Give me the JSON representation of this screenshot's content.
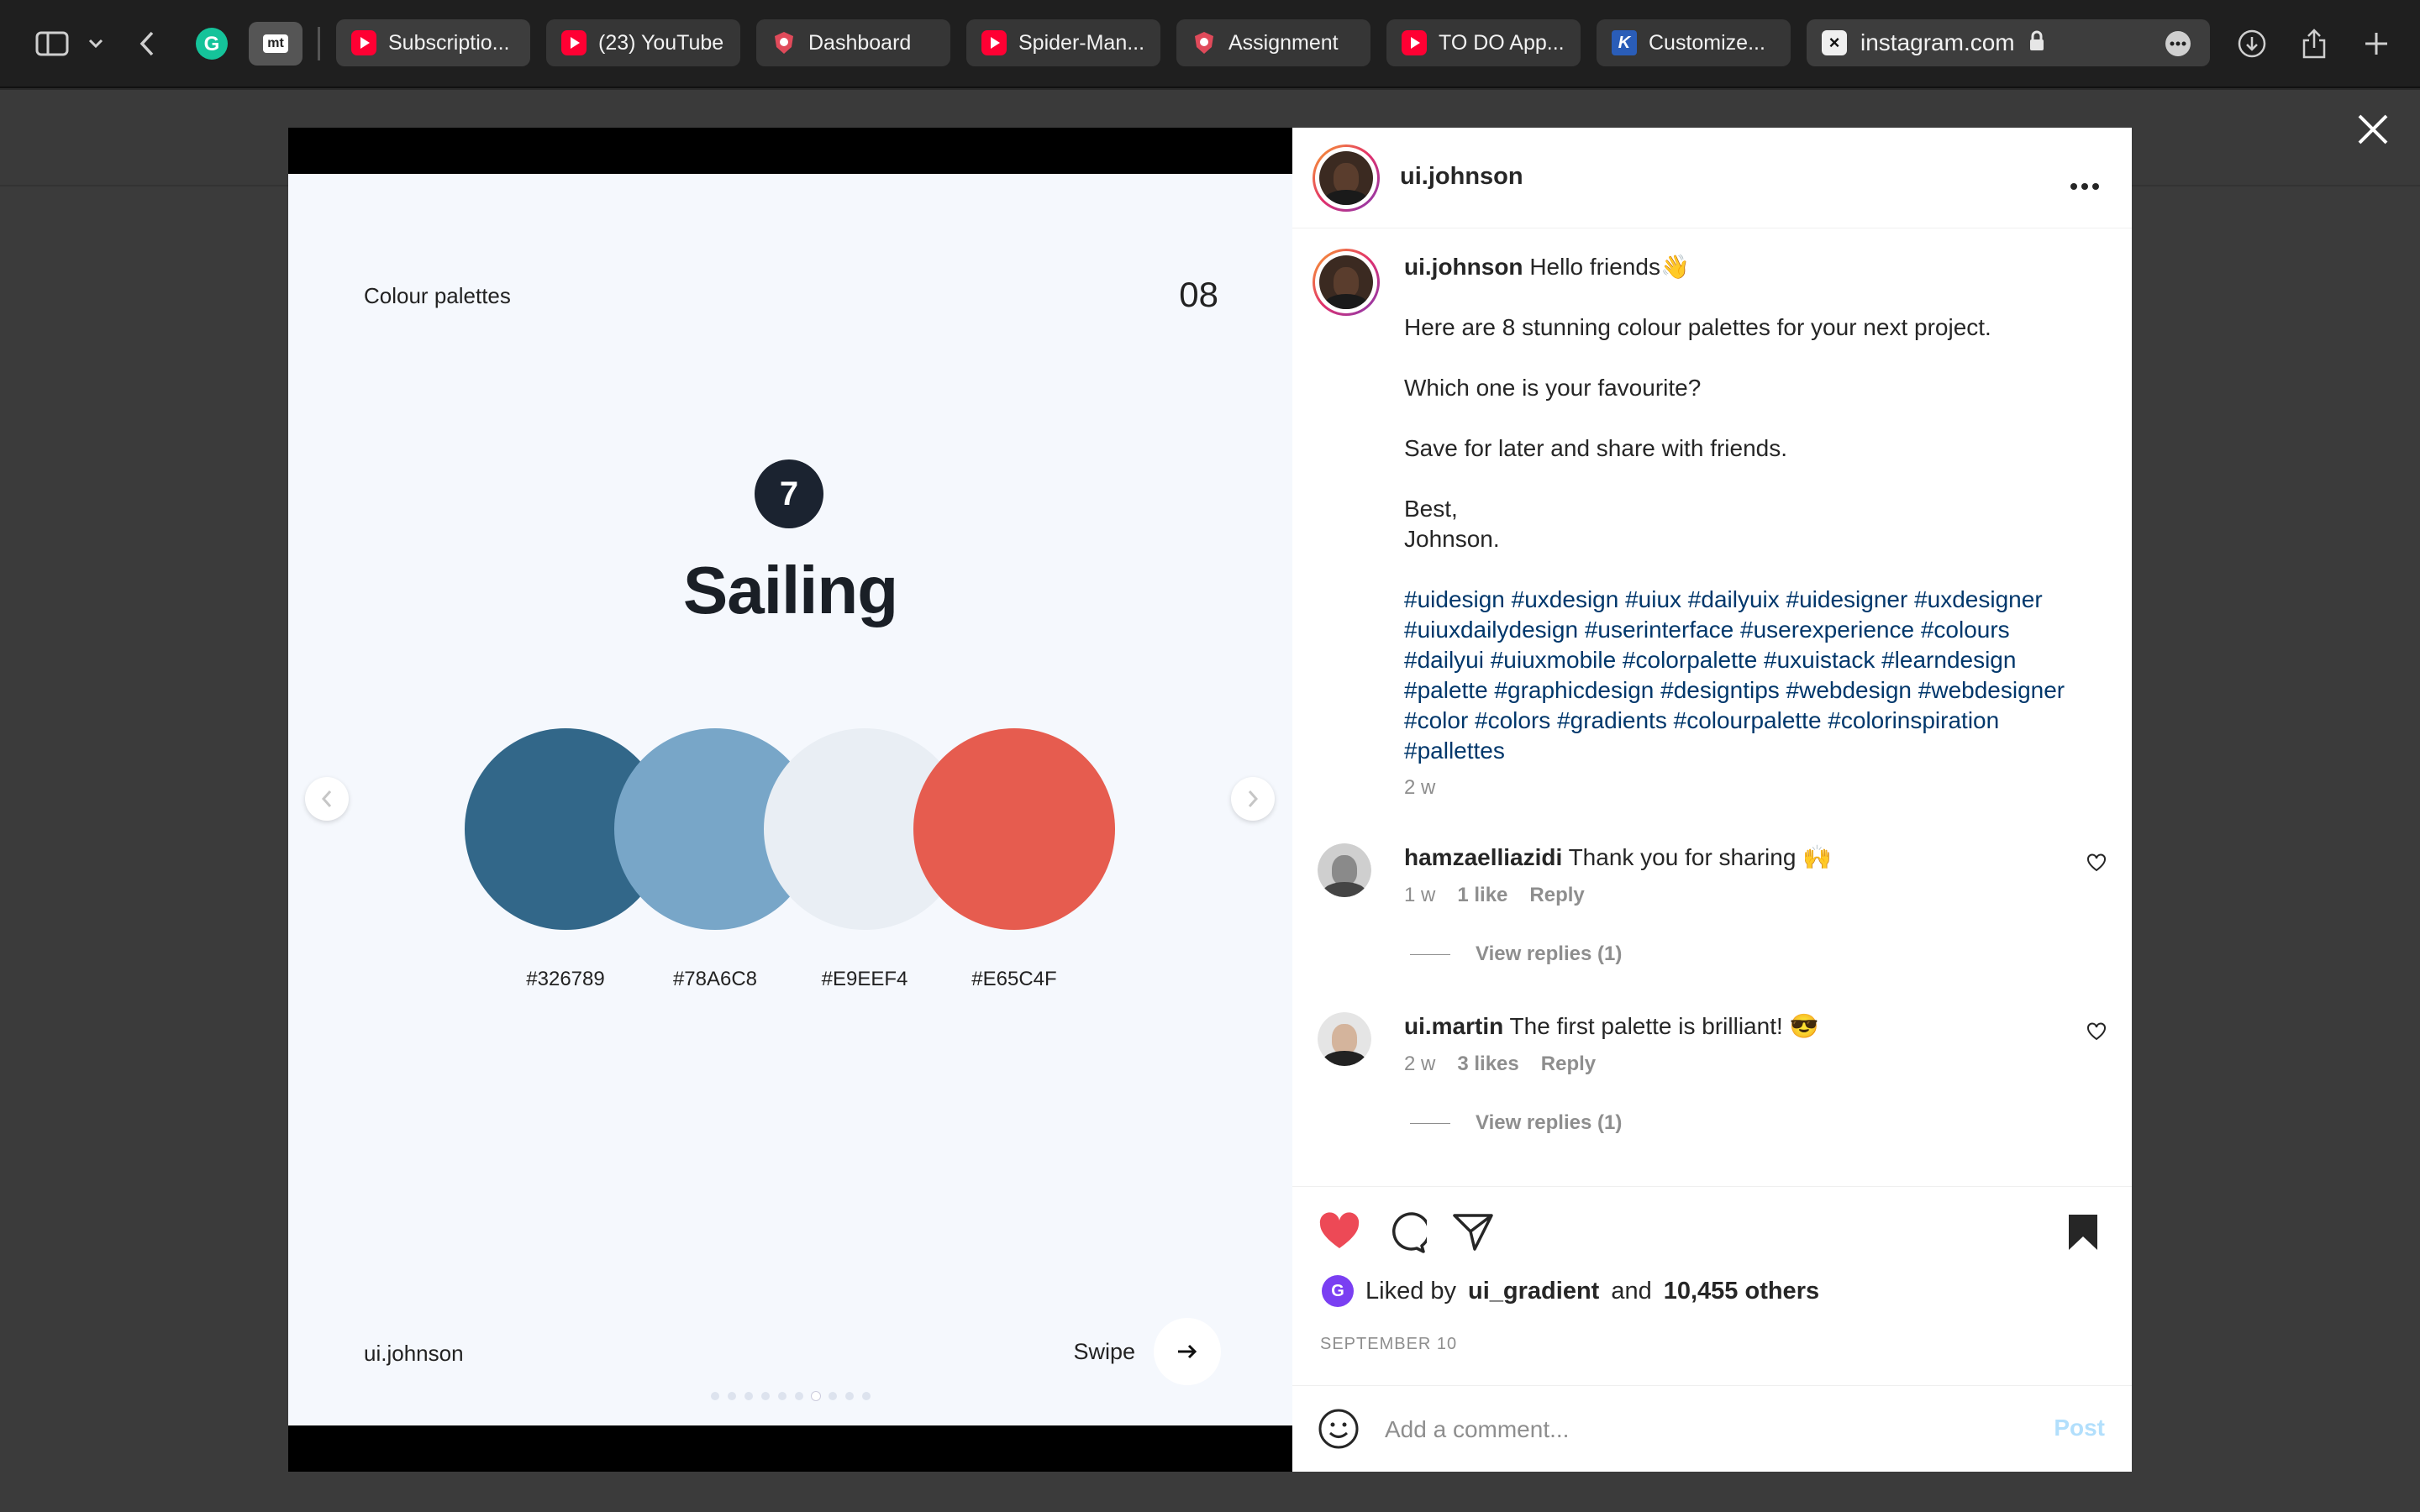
{
  "browser": {
    "tabs": [
      {
        "label": "Subscriptio...",
        "icon": "youtube-icon"
      },
      {
        "label": "(23) YouTube",
        "icon": "youtube-icon"
      },
      {
        "label": "Dashboard",
        "icon": "shield-icon"
      },
      {
        "label": "Spider-Man...",
        "icon": "youtube-icon"
      },
      {
        "label": "Assignment",
        "icon": "shield-icon"
      },
      {
        "label": "TO DO App...",
        "icon": "youtube-icon"
      },
      {
        "label": "Customize...",
        "icon": "k-icon"
      }
    ],
    "address": "instagram.com",
    "extension_letter": "mt"
  },
  "slide": {
    "title": "Colour palettes",
    "number": "08",
    "badge": "7",
    "palette_name": "Sailing",
    "swatches": [
      {
        "hex": "#326789",
        "color": "#326789"
      },
      {
        "hex": "#78A6C8",
        "color": "#78A6C8"
      },
      {
        "hex": "#E9EEF4",
        "color": "#E9EEF4"
      },
      {
        "hex": "#E65C4F",
        "color": "#E65C4F"
      }
    ],
    "footer_user": "ui.johnson",
    "swipe_label": "Swipe",
    "dots_count": 10,
    "active_dot": 7
  },
  "post": {
    "username": "ui.johnson",
    "caption_user": "ui.johnson",
    "caption_first": "Hello friends👋",
    "caption_lines": [
      "Here are 8 stunning colour palettes for your next project.",
      "Which one is your favourite?",
      "Save for later and share with friends."
    ],
    "signoff_1": "Best,",
    "signoff_2": "Johnson.",
    "hashtags": "#uidesign #uxdesign #uiux #dailyuix #uidesigner #uxdesigner #uiuxdailydesign #userinterface #userexperience #colours #dailyui #uiuxmobile #colorpalette #uxuistack #learndesign #palette #graphicdesign #designtips #webdesign #webdesigner #color #colors #gradients #colourpalette #colorinspiration #pallettes",
    "caption_time": "2 w",
    "comments": [
      {
        "user": "hamzaelliazidi",
        "text": "Thank you for sharing 🙌",
        "time": "1 w",
        "likes": "1 like",
        "reply": "Reply",
        "view_replies": "View replies (1)"
      },
      {
        "user": "ui.martin",
        "text": "The first palette is brilliant! 😎",
        "time": "2 w",
        "likes": "3 likes",
        "reply": "Reply",
        "view_replies": "View replies (1)"
      }
    ],
    "liked_by_prefix": "Liked by",
    "liked_by_user": "ui_gradient",
    "liked_by_and": "and",
    "liked_by_others": "10,455 others",
    "date": "SEPTEMBER 10",
    "comment_placeholder": "Add a comment...",
    "post_button": "Post",
    "colors": {
      "like": "#ed4956",
      "link": "#00376b",
      "muted": "#8e8e8e"
    }
  }
}
